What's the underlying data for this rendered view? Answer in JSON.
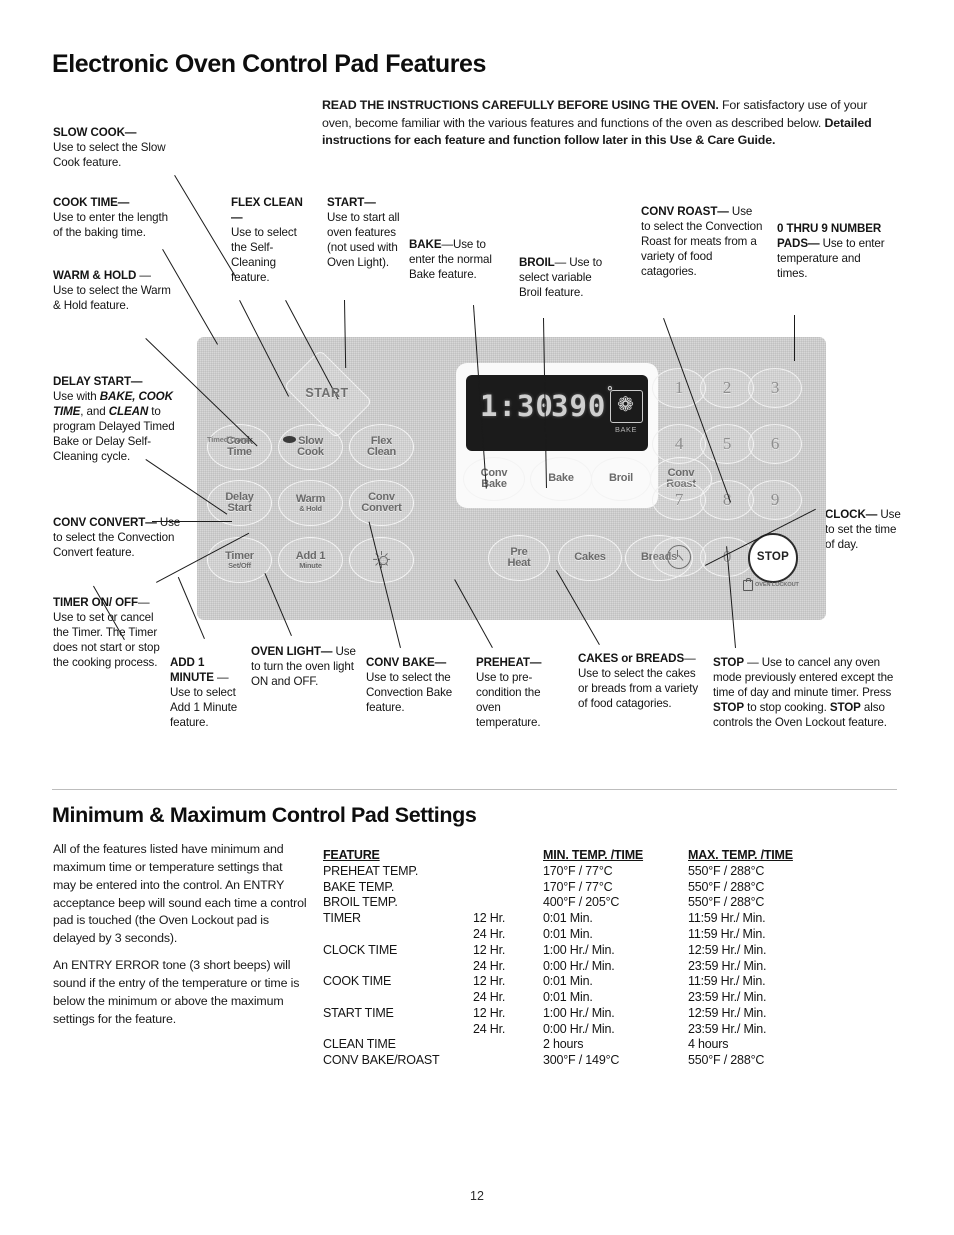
{
  "page": {
    "title": "Electronic Oven Control Pad Features",
    "number": "12"
  },
  "intro": {
    "lead": "READ THE INSTRUCTIONS CAREFULLY BEFORE USING THE OVEN.",
    "mid": " For satisfactory use of your oven, become familiar with the various features and functions of the oven as described below. ",
    "bold_tail": "Detailed instructions for each feature and function follow later in this Use & Care Guide."
  },
  "callouts": {
    "slow_cook": {
      "term": "SLOW COOK—",
      "text": "Use to select the Slow Cook feature."
    },
    "cook_time": {
      "term": "COOK TIME—",
      "text": "Use to enter the length of the baking time."
    },
    "warm_hold": {
      "term": "WARM & HOLD",
      "text": " — Use to select the Warm & Hold feature."
    },
    "delay_start": {
      "term": "DELAY START—",
      "t1": "Use with ",
      "i1": "BAKE, COOK TIME",
      "t2": ", and ",
      "i2": "CLEAN",
      "t3": " to program Delayed Timed Bake or Delay Self-Cleaning cycle."
    },
    "conv_convert": {
      "term": "CONV CONVERT—",
      "text": "Use to select the Convection Convert feature."
    },
    "timer_on_off": {
      "term": "TIMER ON/ OFF",
      "text": "— Use to set or cancel the Timer. The Timer does not start or stop the cooking process."
    },
    "flex_clean": {
      "term": "FLEX CLEAN—",
      "text": "Use to select the Self-Cleaning feature."
    },
    "start": {
      "term": "START—",
      "text": "Use to start all oven features (not used with Oven Light)."
    },
    "bake": {
      "term": "BAKE",
      "text": "—Use to enter the normal Bake feature."
    },
    "broil": {
      "term": "BROIL",
      "text": "— Use to select variable Broil feature."
    },
    "conv_roast": {
      "term": "CONV ROAST—",
      "text": "Use to select the Convection Roast for meats from a variety of food catagories."
    },
    "number_pads": {
      "term": "0 THRU 9 NUMBER PADS—",
      "text": "Use to enter temperature and times."
    },
    "clock": {
      "term": "CLOCK—",
      "text": "Use to set the time of day."
    },
    "add_1_minute": {
      "term": "ADD 1 MINUTE",
      "text": " — Use to select Add 1 Minute feature."
    },
    "oven_light": {
      "term": "OVEN LIGHT—",
      "text": "Use to turn the oven light ON and OFF."
    },
    "conv_bake": {
      "term": "CONV BAKE—",
      "text": "Use to select the Convection Bake feature."
    },
    "preheat": {
      "term": "PREHEAT—",
      "text": "Use to pre-condition the oven temperature."
    },
    "cakes_breads": {
      "term": "CAKES or BREADS",
      "text": "— Use to select the cakes or breads from a variety of food catagories."
    },
    "stop": {
      "term": "STOP",
      "t1": " — Use to cancel any oven mode previously entered except the time of day and minute timer. Press ",
      "b1": "STOP",
      "t2": " to stop cooking. ",
      "b2": "STOP",
      "t3": " also controls the Oven Lockout feature."
    }
  },
  "panel": {
    "display": {
      "time": "1:30",
      "temp": "390",
      "degree": "°",
      "mode_label": "BAKE",
      "fan_glyph": "❁"
    },
    "timed_oven_label": "Timed Oven",
    "oven_lockout_label": "OVEN LOCKOUT",
    "keys": {
      "start": "START",
      "cook_time_l1": "Cook",
      "cook_time_l2": "Time",
      "slow_cook_l1": "Slow",
      "slow_cook_l2": "Cook",
      "flex_clean_l1": "Flex",
      "flex_clean_l2": "Clean",
      "delay_start_l1": "Delay",
      "delay_start_l2": "Start",
      "warm_hold_l1": "Warm",
      "warm_hold_l2": "& Hold",
      "conv_convert_l1": "Conv",
      "conv_convert_l2": "Convert",
      "timer_l1": "Timer",
      "timer_l2": "Set/Off",
      "add1_l1": "Add 1",
      "add1_l2": "Minute",
      "conv_bake_l1": "Conv",
      "conv_bake_l2": "Bake",
      "bake": "Bake",
      "broil": "Broil",
      "conv_roast_l1": "Conv",
      "conv_roast_l2": "Roast",
      "preheat_l1": "Pre",
      "preheat_l2": "Heat",
      "cakes": "Cakes",
      "breads": "Breads",
      "stop": "STOP"
    },
    "numbers": [
      "1",
      "2",
      "3",
      "4",
      "5",
      "6",
      "7",
      "8",
      "9",
      "0"
    ]
  },
  "minmax": {
    "heading": "Minimum & Maximum Control Pad Settings",
    "para1": "All of the features listed have minimum and maximum time or temperature settings that may be entered into the control.  An ENTRY acceptance beep will sound each time a control pad is touched (the Oven Lockout pad is delayed by 3 seconds).",
    "para2": "An ENTRY ERROR tone (3 short beeps) will sound if the entry of the temperature or time is below the minimum or above the maximum settings for the feature.",
    "headers": [
      "FEATURE",
      "MIN. TEMP. /TIME",
      "MAX. TEMP. /TIME"
    ],
    "rows": [
      {
        "feature": "PREHEAT TEMP.",
        "hr": "",
        "min": "170°F / 77°C",
        "max": "550°F / 288°C"
      },
      {
        "feature": "BAKE TEMP.",
        "hr": "",
        "min": "170°F / 77°C",
        "max": "550°F / 288°C"
      },
      {
        "feature": "BROIL TEMP.",
        "hr": "",
        "min": "400°F / 205°C",
        "max": "550°F / 288°C"
      },
      {
        "feature": "TIMER",
        "hr": "12 Hr.",
        "min": "0:01 Min.",
        "max": "11:59 Hr./ Min."
      },
      {
        "feature": "",
        "hr": "24 Hr.",
        "min": "0:01 Min.",
        "max": "11:59 Hr./ Min."
      },
      {
        "feature": "CLOCK TIME",
        "hr": "12 Hr.",
        "min": "1:00 Hr./ Min.",
        "max": "12:59 Hr./ Min."
      },
      {
        "feature": "",
        "hr": "24 Hr.",
        "min": "0:00 Hr./ Min.",
        "max": "23:59 Hr./ Min."
      },
      {
        "feature": "COOK TIME",
        "hr": "12 Hr.",
        "min": "0:01 Min.",
        "max": "11:59 Hr./ Min."
      },
      {
        "feature": "",
        "hr": "24 Hr.",
        "min": "0:01 Min.",
        "max": "23:59 Hr./ Min."
      },
      {
        "feature": "START TIME",
        "hr": "12 Hr.",
        "min": "1:00 Hr./ Min.",
        "max": "12:59 Hr./ Min."
      },
      {
        "feature": "",
        "hr": "24 Hr.",
        "min": "0:00 Hr./ Min.",
        "max": "23:59 Hr./ Min."
      },
      {
        "feature": "CLEAN TIME",
        "hr": "",
        "min": "2 hours",
        "max": "4 hours"
      },
      {
        "feature": "CONV BAKE/ROAST",
        "hr": "",
        "min": "300°F / 149°C",
        "max": "550°F / 288°C"
      }
    ]
  }
}
